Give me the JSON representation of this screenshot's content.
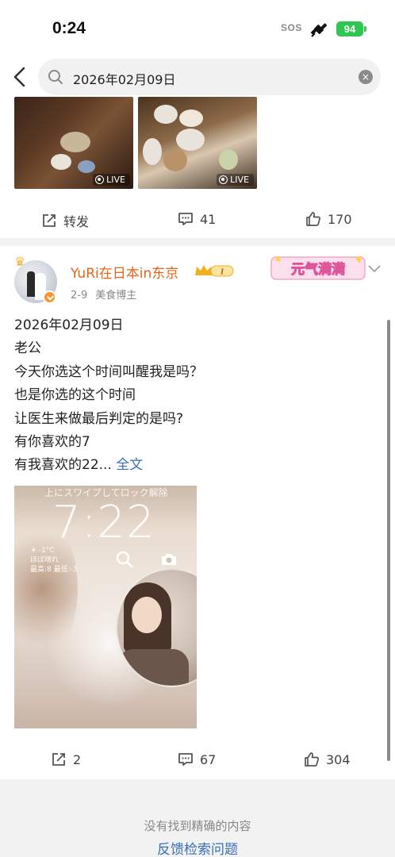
{
  "status_bar": {
    "time": "0:24",
    "sos": "SOS",
    "battery": "94",
    "battery_color": "#2fc653"
  },
  "search": {
    "query": "2026年02月09日",
    "clear_icon": "×"
  },
  "post1": {
    "images": [
      {
        "badge": "LIVE"
      },
      {
        "badge": "LIVE"
      }
    ],
    "actions": {
      "repost": "转发",
      "comments": "41",
      "likes": "170"
    }
  },
  "post2": {
    "username": "YuRi在日本in东京",
    "vip_level": "I",
    "date": "2-9",
    "tag": "美食博主",
    "sticker_text": "元气满满",
    "content_lines": [
      "2026年02月09日",
      "老公",
      "今天你选这个时间叫醒我是吗？",
      "也是你选的这个时间",
      "让医生来做最后判定的是吗?",
      "有你喜欢的7",
      "有我喜欢的22..."
    ],
    "more_label": "全文",
    "photo": {
      "top_text": "上にスワイプしてロック解除",
      "clock": "7:22",
      "weather_lines": [
        "☀ -1°C",
        "ほぼ晴れ",
        "最高:8 最低:-3"
      ]
    },
    "actions": {
      "reposts": "2",
      "comments": "67",
      "likes": "304"
    }
  },
  "footer": {
    "note": "没有找到精确的内容",
    "link": "反馈检索问题"
  },
  "colors": {
    "username": "#e3651a",
    "link": "#3a6fb6",
    "divider": "#f2f2f2"
  }
}
